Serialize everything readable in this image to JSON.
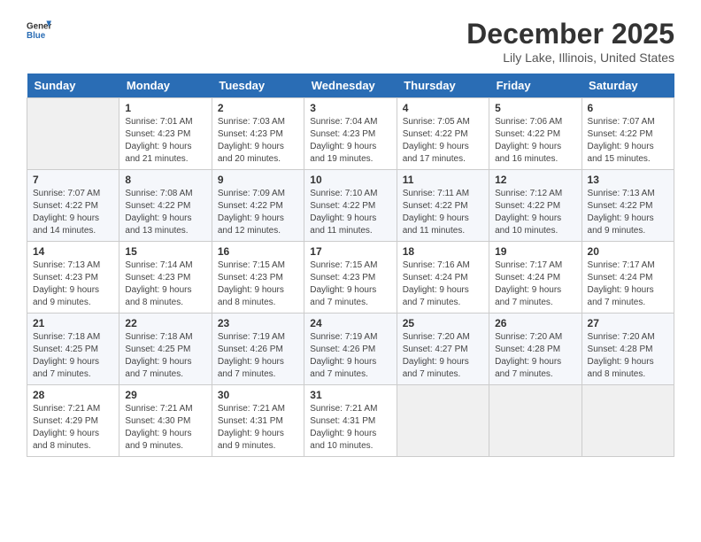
{
  "header": {
    "logo_line1": "General",
    "logo_line2": "Blue",
    "month_title": "December 2025",
    "location": "Lily Lake, Illinois, United States"
  },
  "weekdays": [
    "Sunday",
    "Monday",
    "Tuesday",
    "Wednesday",
    "Thursday",
    "Friday",
    "Saturday"
  ],
  "weeks": [
    [
      {
        "day": "",
        "sunrise": "",
        "sunset": "",
        "daylight": "",
        "empty": true
      },
      {
        "day": "1",
        "sunrise": "Sunrise: 7:01 AM",
        "sunset": "Sunset: 4:23 PM",
        "daylight": "Daylight: 9 hours and 21 minutes."
      },
      {
        "day": "2",
        "sunrise": "Sunrise: 7:03 AM",
        "sunset": "Sunset: 4:23 PM",
        "daylight": "Daylight: 9 hours and 20 minutes."
      },
      {
        "day": "3",
        "sunrise": "Sunrise: 7:04 AM",
        "sunset": "Sunset: 4:23 PM",
        "daylight": "Daylight: 9 hours and 19 minutes."
      },
      {
        "day": "4",
        "sunrise": "Sunrise: 7:05 AM",
        "sunset": "Sunset: 4:22 PM",
        "daylight": "Daylight: 9 hours and 17 minutes."
      },
      {
        "day": "5",
        "sunrise": "Sunrise: 7:06 AM",
        "sunset": "Sunset: 4:22 PM",
        "daylight": "Daylight: 9 hours and 16 minutes."
      },
      {
        "day": "6",
        "sunrise": "Sunrise: 7:07 AM",
        "sunset": "Sunset: 4:22 PM",
        "daylight": "Daylight: 9 hours and 15 minutes."
      }
    ],
    [
      {
        "day": "7",
        "sunrise": "Sunrise: 7:07 AM",
        "sunset": "Sunset: 4:22 PM",
        "daylight": "Daylight: 9 hours and 14 minutes."
      },
      {
        "day": "8",
        "sunrise": "Sunrise: 7:08 AM",
        "sunset": "Sunset: 4:22 PM",
        "daylight": "Daylight: 9 hours and 13 minutes."
      },
      {
        "day": "9",
        "sunrise": "Sunrise: 7:09 AM",
        "sunset": "Sunset: 4:22 PM",
        "daylight": "Daylight: 9 hours and 12 minutes."
      },
      {
        "day": "10",
        "sunrise": "Sunrise: 7:10 AM",
        "sunset": "Sunset: 4:22 PM",
        "daylight": "Daylight: 9 hours and 11 minutes."
      },
      {
        "day": "11",
        "sunrise": "Sunrise: 7:11 AM",
        "sunset": "Sunset: 4:22 PM",
        "daylight": "Daylight: 9 hours and 11 minutes."
      },
      {
        "day": "12",
        "sunrise": "Sunrise: 7:12 AM",
        "sunset": "Sunset: 4:22 PM",
        "daylight": "Daylight: 9 hours and 10 minutes."
      },
      {
        "day": "13",
        "sunrise": "Sunrise: 7:13 AM",
        "sunset": "Sunset: 4:22 PM",
        "daylight": "Daylight: 9 hours and 9 minutes."
      }
    ],
    [
      {
        "day": "14",
        "sunrise": "Sunrise: 7:13 AM",
        "sunset": "Sunset: 4:23 PM",
        "daylight": "Daylight: 9 hours and 9 minutes."
      },
      {
        "day": "15",
        "sunrise": "Sunrise: 7:14 AM",
        "sunset": "Sunset: 4:23 PM",
        "daylight": "Daylight: 9 hours and 8 minutes."
      },
      {
        "day": "16",
        "sunrise": "Sunrise: 7:15 AM",
        "sunset": "Sunset: 4:23 PM",
        "daylight": "Daylight: 9 hours and 8 minutes."
      },
      {
        "day": "17",
        "sunrise": "Sunrise: 7:15 AM",
        "sunset": "Sunset: 4:23 PM",
        "daylight": "Daylight: 9 hours and 7 minutes."
      },
      {
        "day": "18",
        "sunrise": "Sunrise: 7:16 AM",
        "sunset": "Sunset: 4:24 PM",
        "daylight": "Daylight: 9 hours and 7 minutes."
      },
      {
        "day": "19",
        "sunrise": "Sunrise: 7:17 AM",
        "sunset": "Sunset: 4:24 PM",
        "daylight": "Daylight: 9 hours and 7 minutes."
      },
      {
        "day": "20",
        "sunrise": "Sunrise: 7:17 AM",
        "sunset": "Sunset: 4:24 PM",
        "daylight": "Daylight: 9 hours and 7 minutes."
      }
    ],
    [
      {
        "day": "21",
        "sunrise": "Sunrise: 7:18 AM",
        "sunset": "Sunset: 4:25 PM",
        "daylight": "Daylight: 9 hours and 7 minutes."
      },
      {
        "day": "22",
        "sunrise": "Sunrise: 7:18 AM",
        "sunset": "Sunset: 4:25 PM",
        "daylight": "Daylight: 9 hours and 7 minutes."
      },
      {
        "day": "23",
        "sunrise": "Sunrise: 7:19 AM",
        "sunset": "Sunset: 4:26 PM",
        "daylight": "Daylight: 9 hours and 7 minutes."
      },
      {
        "day": "24",
        "sunrise": "Sunrise: 7:19 AM",
        "sunset": "Sunset: 4:26 PM",
        "daylight": "Daylight: 9 hours and 7 minutes."
      },
      {
        "day": "25",
        "sunrise": "Sunrise: 7:20 AM",
        "sunset": "Sunset: 4:27 PM",
        "daylight": "Daylight: 9 hours and 7 minutes."
      },
      {
        "day": "26",
        "sunrise": "Sunrise: 7:20 AM",
        "sunset": "Sunset: 4:28 PM",
        "daylight": "Daylight: 9 hours and 7 minutes."
      },
      {
        "day": "27",
        "sunrise": "Sunrise: 7:20 AM",
        "sunset": "Sunset: 4:28 PM",
        "daylight": "Daylight: 9 hours and 8 minutes."
      }
    ],
    [
      {
        "day": "28",
        "sunrise": "Sunrise: 7:21 AM",
        "sunset": "Sunset: 4:29 PM",
        "daylight": "Daylight: 9 hours and 8 minutes."
      },
      {
        "day": "29",
        "sunrise": "Sunrise: 7:21 AM",
        "sunset": "Sunset: 4:30 PM",
        "daylight": "Daylight: 9 hours and 9 minutes."
      },
      {
        "day": "30",
        "sunrise": "Sunrise: 7:21 AM",
        "sunset": "Sunset: 4:31 PM",
        "daylight": "Daylight: 9 hours and 9 minutes."
      },
      {
        "day": "31",
        "sunrise": "Sunrise: 7:21 AM",
        "sunset": "Sunset: 4:31 PM",
        "daylight": "Daylight: 9 hours and 10 minutes."
      },
      {
        "day": "",
        "sunrise": "",
        "sunset": "",
        "daylight": "",
        "empty": true
      },
      {
        "day": "",
        "sunrise": "",
        "sunset": "",
        "daylight": "",
        "empty": true
      },
      {
        "day": "",
        "sunrise": "",
        "sunset": "",
        "daylight": "",
        "empty": true
      }
    ]
  ]
}
